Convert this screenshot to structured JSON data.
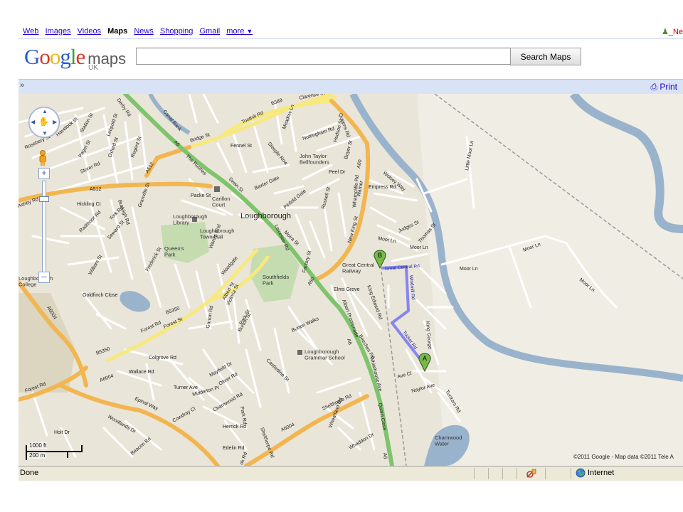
{
  "nav": {
    "items": [
      "Web",
      "Images",
      "Videos",
      "Maps",
      "News",
      "Shopping",
      "Gmail"
    ],
    "current": "Maps",
    "more": "more",
    "more_arrow": "▼",
    "user_link": "_Ne"
  },
  "logo": {
    "brand": "Google",
    "product": "maps",
    "region": "UK"
  },
  "search": {
    "value": "",
    "placeholder": "",
    "button": "Search Maps"
  },
  "toolbar": {
    "toggle": "»",
    "print": "Print"
  },
  "map": {
    "place_labels": {
      "loughborough": "Loughborough",
      "queens_park": "Queen's\nPark",
      "southfields_park": "Southfields\nPark",
      "carillon_court": "Carillon\nCourt",
      "library": "Loughborough\nLibrary",
      "town_hall": "Loughborough\nTown Hall",
      "john_taylor": "John Taylor\nBellfounders",
      "gcr": "Great Central\nRailway",
      "grammar": "Loughborough\nGrammar School",
      "charnwood_water": "Charnwood\nWater",
      "college": "Loughborough\nCollege"
    },
    "road_labels": {
      "derby_rd": "Derby Rd",
      "toothill_rd": "Toothill Rd",
      "clarence_st": "Clarence St",
      "b589": "B589",
      "bridge_st": "Bridge St",
      "nottingham_rd": "Nottingham Rd",
      "steeple_row": "Steeple Row",
      "fennel_st": "Fennel St",
      "a512_1": "A512",
      "a512_2": "A512",
      "a6_1": "A6",
      "the_rushes": "The Rushes",
      "swan_st": "Swan St",
      "baxter_gate": "Baxter Gate",
      "peel_dr": "Peel Dr",
      "empress_rd": "Empress Rd",
      "a60_1": "A60",
      "a60_2": "A60",
      "new_king_st": "New King St",
      "wharncliffe_rd": "Wharncliffe Rd",
      "moor_ln_1": "Moor Ln",
      "moor_ln_2": "Moor Ln",
      "moor_ln_3": "Moor Ln",
      "moor_ln_4": "Moor Ln",
      "little_moor_ln": "Little Moor Ln",
      "judges_st": "Judges St",
      "thomas_st": "Thomas St",
      "great_central_rd": "Great Central Rd",
      "windmill_rd": "Windmill Rd",
      "tucker_rd": "Tucker Rd",
      "naylor_ave": "Naylor Ave",
      "tuckers_rd": "Tuckers Rd",
      "king_george": "King George",
      "b5350_1": "B5350",
      "b5350_2": "B5350",
      "forest_rd": "Forest Rd",
      "a6004_1": "A6004",
      "a6004_2": "A6004",
      "a6004_3": "A6004",
      "epinal_way": "Epinal Way",
      "shelthorpe_rd": "Shelthorpe Rd",
      "leicester_rd": "Leicester Rd",
      "woodgate": "Woodgate",
      "burton_walks": "Burton Walks",
      "elms_grove": "Elms Grove",
      "king_edward_rd": "King Edward Rd",
      "albert_promenade": "Albert Promenade",
      "beeches_rd": "Beeches Rd",
      "whitehouse_ave": "Whitehouse Ave",
      "quorn_close": "Quorn Close",
      "ashby_rd": "Ashby Rd",
      "hickling_ct": "Hickling Ct",
      "radmoor_rd": "Radmoor Rd",
      "york_rd": "York Rd",
      "seward_st": "Seward St",
      "william_st": "William St",
      "goldfinch_close": "Goldfinch Close",
      "forest_rd2": "Forest Rd",
      "wallace_rd": "Wallace Rd",
      "colgrove_rd": "Colgrove Rd",
      "turner_ave": "Turner Ave",
      "mayfield_dr": "Mayfield Dr",
      "charnwood_rd": "Charnwood Rd",
      "herrick_rd": "Herrick Rd",
      "edelin_rd": "Edelin Rd",
      "beacon_rd": "Beacon Rd",
      "woodlands_dr": "Woodlands Dr",
      "holt_dr": "Holt Dr",
      "whaddon_dr": "Whaddon Dr",
      "wheatland_rd": "Wheatland Rd",
      "castledine_st": "Castledine St",
      "victoria_st": "Victoria St",
      "park_st": "Park St",
      "garton_rd": "Garton Rd",
      "frederick_st": "Frederick St",
      "burleigh_rd": "Burleigh Rd",
      "granville_st": "Granville St",
      "oxford_st": "Oxford St",
      "regent_st": "Regent St",
      "leopold_st": "Leopold St",
      "paget_st": "Paget St",
      "station_st": "Station St",
      "storer_rd": "Storer Rd",
      "havelock_st": "Havelock St",
      "rosebery_st": "Rosebery St",
      "packe_st": "Packe St",
      "moira_st": "Moira St",
      "pinfold_gate": "Pinfold Gate",
      "russell_st": "Russell St",
      "factory_st": "Factory St",
      "wolsey_way": "Wolsey Way",
      "warner": "Warner",
      "boyer_st": "Boyer St",
      "hudson_st": "Hudson St",
      "queens_rd": "Queens Rd",
      "meadow_ln": "Meadow Ln",
      "leckside_rd": "Leckside Rd",
      "forest_st": "Forest St",
      "a6_2": "A6",
      "a6_3": "A6",
      "canal_bank": "Canal Bank",
      "howe_rd": "Howe Rd",
      "middleton_pl": "Middleton Pl",
      "oliver_rd": "Oliver Rd",
      "park_rd": "Park Rd",
      "shelthorpe_rd2": "Shelthorpe Rd",
      "burton_st": "Burton St",
      "albert_st": "Albert St",
      "wards_end": "Ward's End",
      "moor_ln_5": "Moor Ln",
      "cowdray_cl": "Cowdray Cl",
      "ave_cl": "Ave Cl",
      "kirk_rd": "ok Rd"
    },
    "markers": {
      "a": "A",
      "b": "B"
    },
    "route_color": "#7b7bf2",
    "scale": {
      "feet": "1000 ft",
      "metres": "200 m"
    },
    "copyright": "©2011 Google - Map data ©2011 Tele A"
  },
  "statusbar": {
    "text": "Done",
    "zone": "Internet"
  }
}
